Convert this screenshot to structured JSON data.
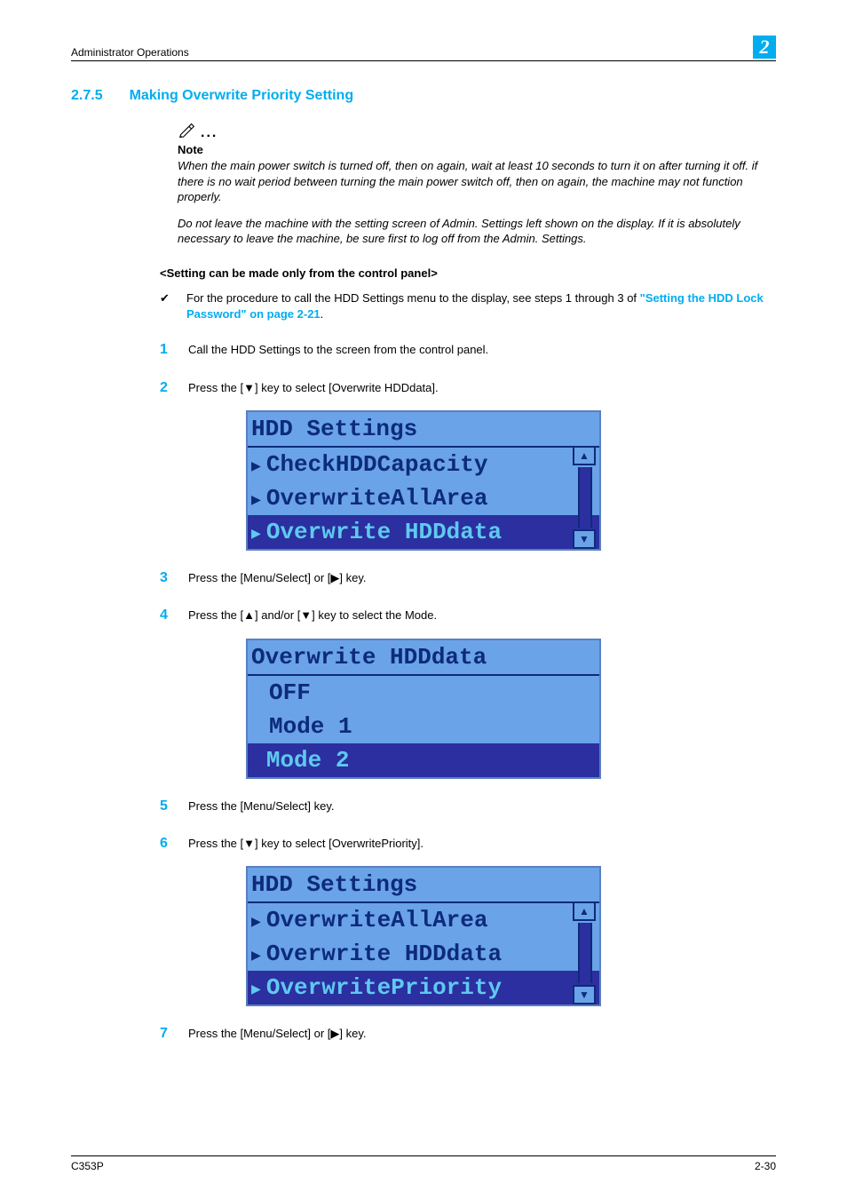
{
  "header": {
    "breadcrumb": "Administrator Operations",
    "chapter": "2"
  },
  "section": {
    "number": "2.7.5",
    "title": "Making Overwrite Priority Setting"
  },
  "note": {
    "label": "Note",
    "p1": "When the main power switch is turned off, then on again, wait at least 10 seconds to turn it on after turning it off. if there is no wait period between turning the main power switch off, then on again, the machine may not function properly.",
    "p2": "Do not leave the machine with the setting screen of Admin. Settings left shown on the display. If it is absolutely necessary to leave the machine, be sure first to log off from the Admin. Settings."
  },
  "subhead": "<Setting can be made only from the control panel>",
  "bullet": {
    "mark": "✔",
    "pre": "For the procedure to call the HDD Settings menu to the display, see steps 1 through 3 of ",
    "link": "\"Setting the HDD Lock Password\" on page 2-21",
    "post": "."
  },
  "steps": {
    "s1": "Call the HDD Settings to the screen from the control panel.",
    "s2": "Press the [▼] key to select [Overwrite HDDdata].",
    "s3": "Press the [Menu/Select] or [▶] key.",
    "s4": "Press the [▲] and/or [▼] key to select the Mode.",
    "s5": "Press the [Menu/Select] key.",
    "s6": "Press the [▼] key to select [OverwritePriority].",
    "s7": "Press the [Menu/Select] or [▶] key."
  },
  "lcd1": {
    "title": "HDD Settings",
    "r1": "CheckHDDCapacity",
    "r2": "OverwriteAllArea",
    "r3": "Overwrite HDDdata"
  },
  "lcd2": {
    "title": "Overwrite HDDdata",
    "r1": "OFF",
    "r2": "Mode 1",
    "r3": "Mode 2"
  },
  "lcd3": {
    "title": "HDD Settings",
    "r1": "OverwriteAllArea",
    "r2": "Overwrite HDDdata",
    "r3": "OverwritePriority"
  },
  "footer": {
    "model": "C353P",
    "pageno": "2-30"
  },
  "nums": {
    "n1": "1",
    "n2": "2",
    "n3": "3",
    "n4": "4",
    "n5": "5",
    "n6": "6",
    "n7": "7"
  }
}
